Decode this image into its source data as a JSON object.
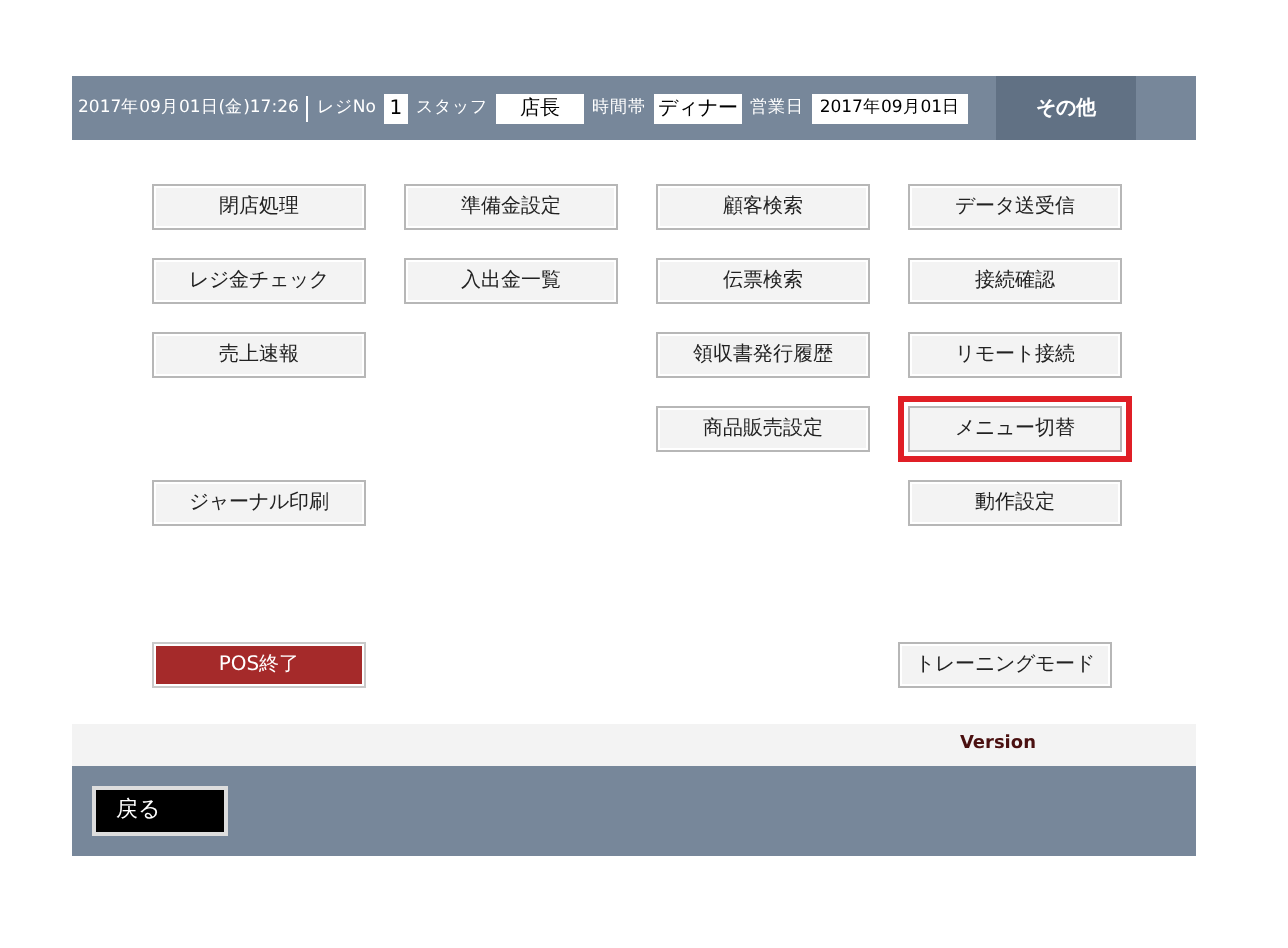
{
  "header": {
    "datetime": "2017年09月01日(金)17:26",
    "fields": [
      {
        "label": "レジNo",
        "value": "1",
        "kind": "narrow"
      },
      {
        "label": "スタッフ",
        "value": "店長",
        "kind": "wide"
      },
      {
        "label": "時間帯",
        "value": "ディナー",
        "kind": "wide"
      },
      {
        "label": "営業日",
        "value": "2017年09月01日",
        "kind": "date"
      }
    ],
    "tab": "その他"
  },
  "menu_rows": [
    [
      {
        "label": "閉店処理",
        "selected": false
      },
      {
        "label": "準備金設定",
        "selected": false
      },
      {
        "label": "顧客検索",
        "selected": false
      },
      {
        "label": "データ送受信",
        "selected": false
      }
    ],
    [
      {
        "label": "レジ金チェック",
        "selected": false
      },
      {
        "label": "入出金一覧",
        "selected": false
      },
      {
        "label": "伝票検索",
        "selected": false
      },
      {
        "label": "接続確認",
        "selected": false
      }
    ],
    [
      {
        "label": "売上速報",
        "selected": false
      },
      null,
      {
        "label": "領収書発行履歴",
        "selected": false
      },
      {
        "label": "リモート接続",
        "selected": false
      }
    ],
    [
      null,
      null,
      {
        "label": "商品販売設定",
        "selected": false
      },
      {
        "label": "メニュー切替",
        "selected": true
      }
    ],
    [
      {
        "label": "ジャーナル印刷",
        "selected": false
      },
      null,
      null,
      {
        "label": "動作設定",
        "selected": false
      }
    ]
  ],
  "bottom_buttons": [
    {
      "label": "POS終了",
      "kind": "danger"
    },
    {
      "label": "トレーニングモード",
      "kind": "normal"
    }
  ],
  "version_label": "Version",
  "back_button": "戻る"
}
